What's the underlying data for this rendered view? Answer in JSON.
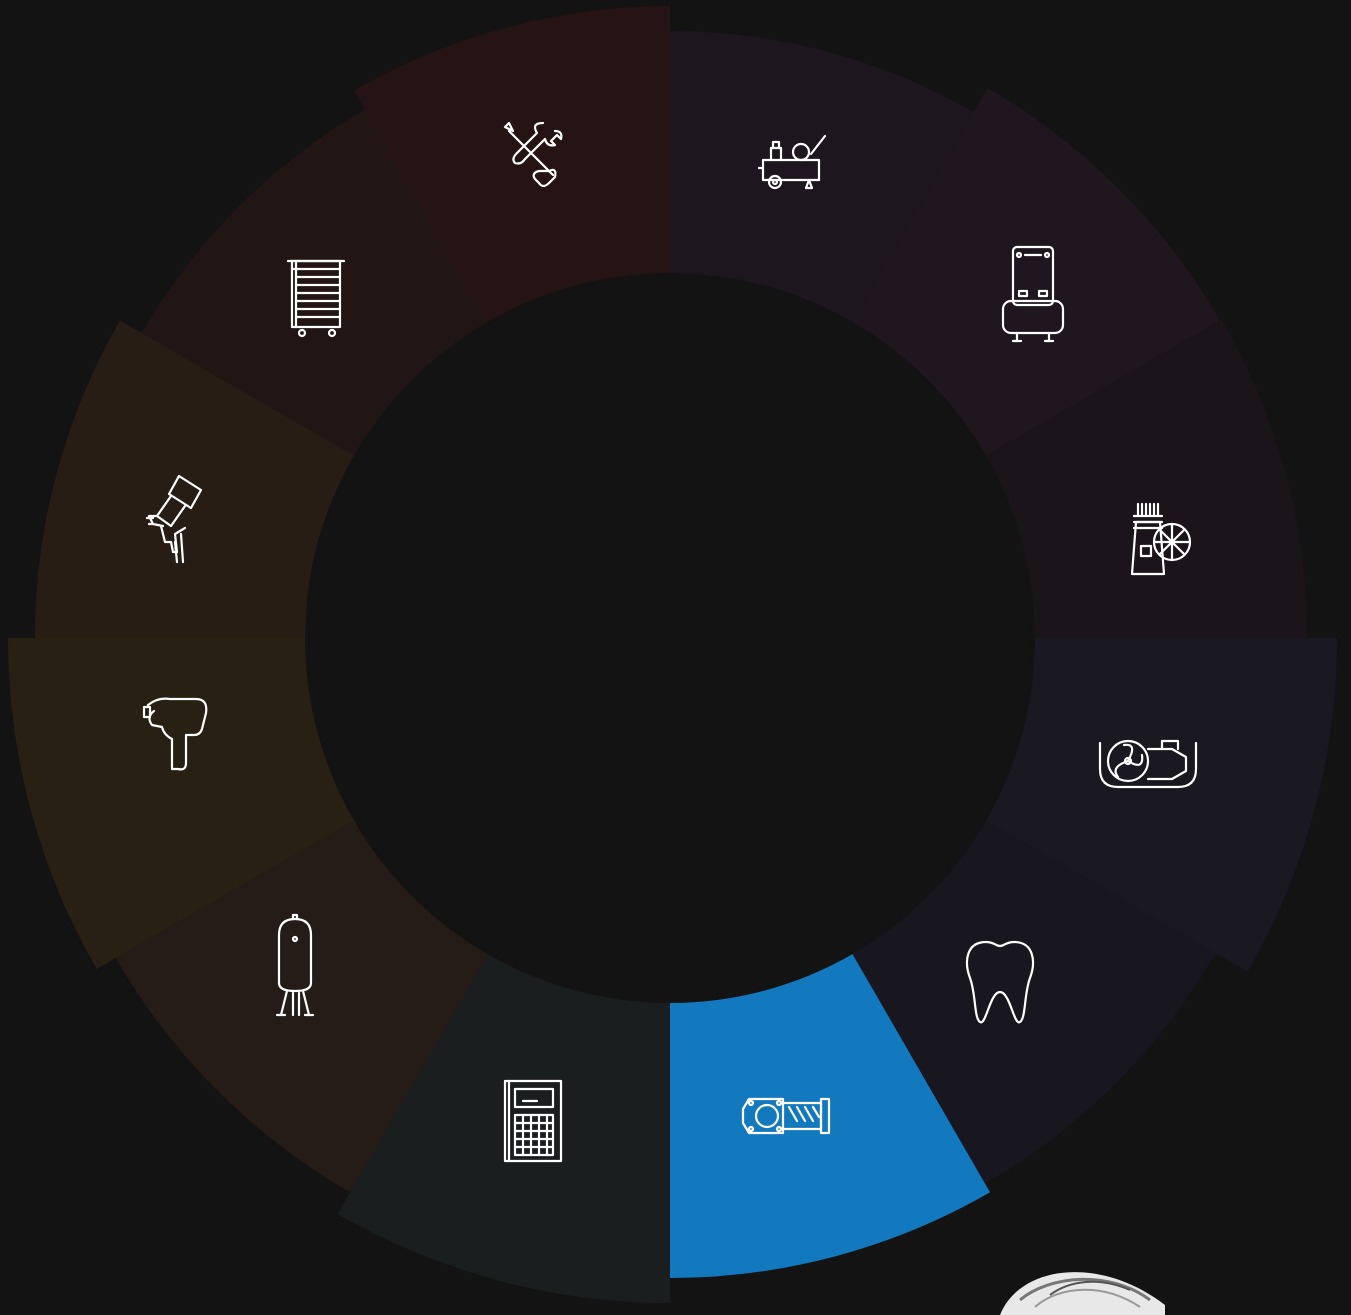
{
  "wheel": {
    "active_index": 6,
    "segments": [
      {
        "icon": "air-compressor-icon",
        "color": "#1e161f"
      },
      {
        "icon": "vertical-tank-compressor-icon",
        "color": "#1f1620"
      },
      {
        "icon": "compressor-pump-icon",
        "color": "#1b151b"
      },
      {
        "icon": "scroll-fan-compressor-icon",
        "color": "#1a1820"
      },
      {
        "icon": "tooth-icon",
        "color": "#18171f"
      },
      {
        "icon": "screw-compressor-icon",
        "color": "#1279be"
      },
      {
        "icon": "control-panel-icon",
        "color": "#1b1e1f"
      },
      {
        "icon": "air-receiver-tank-icon",
        "color": "#251c17"
      },
      {
        "icon": "impact-wrench-icon",
        "color": "#282013"
      },
      {
        "icon": "spray-gun-icon",
        "color": "#281d15"
      },
      {
        "icon": "tool-cabinet-icon",
        "color": "#211613"
      },
      {
        "icon": "tools-service-icon",
        "color": "#261313"
      }
    ]
  },
  "background": "#131313",
  "product_photo": {
    "icon": "product-photo"
  }
}
